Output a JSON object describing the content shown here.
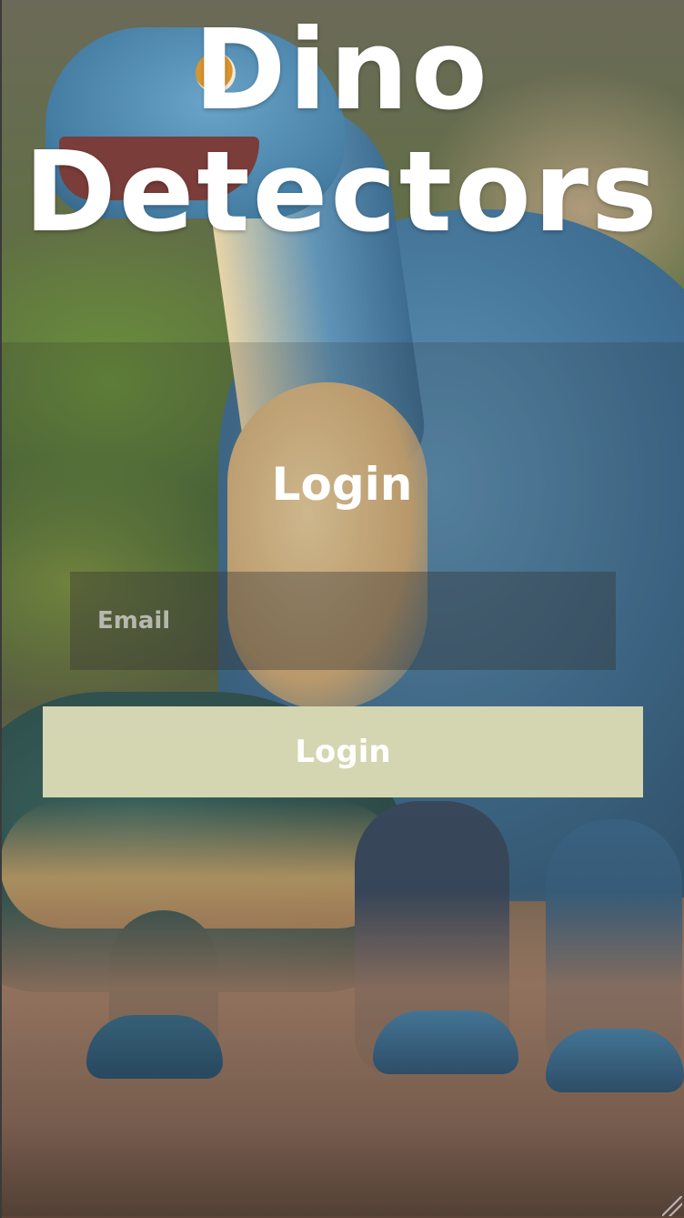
{
  "header": {
    "title_line1": "Dino",
    "title_line2": "Detectors"
  },
  "form": {
    "heading": "Login",
    "email_placeholder": "Email",
    "email_value": "",
    "submit_label": "Login"
  },
  "colors": {
    "button_background": "#d3d6b0",
    "text": "#ffffff"
  }
}
